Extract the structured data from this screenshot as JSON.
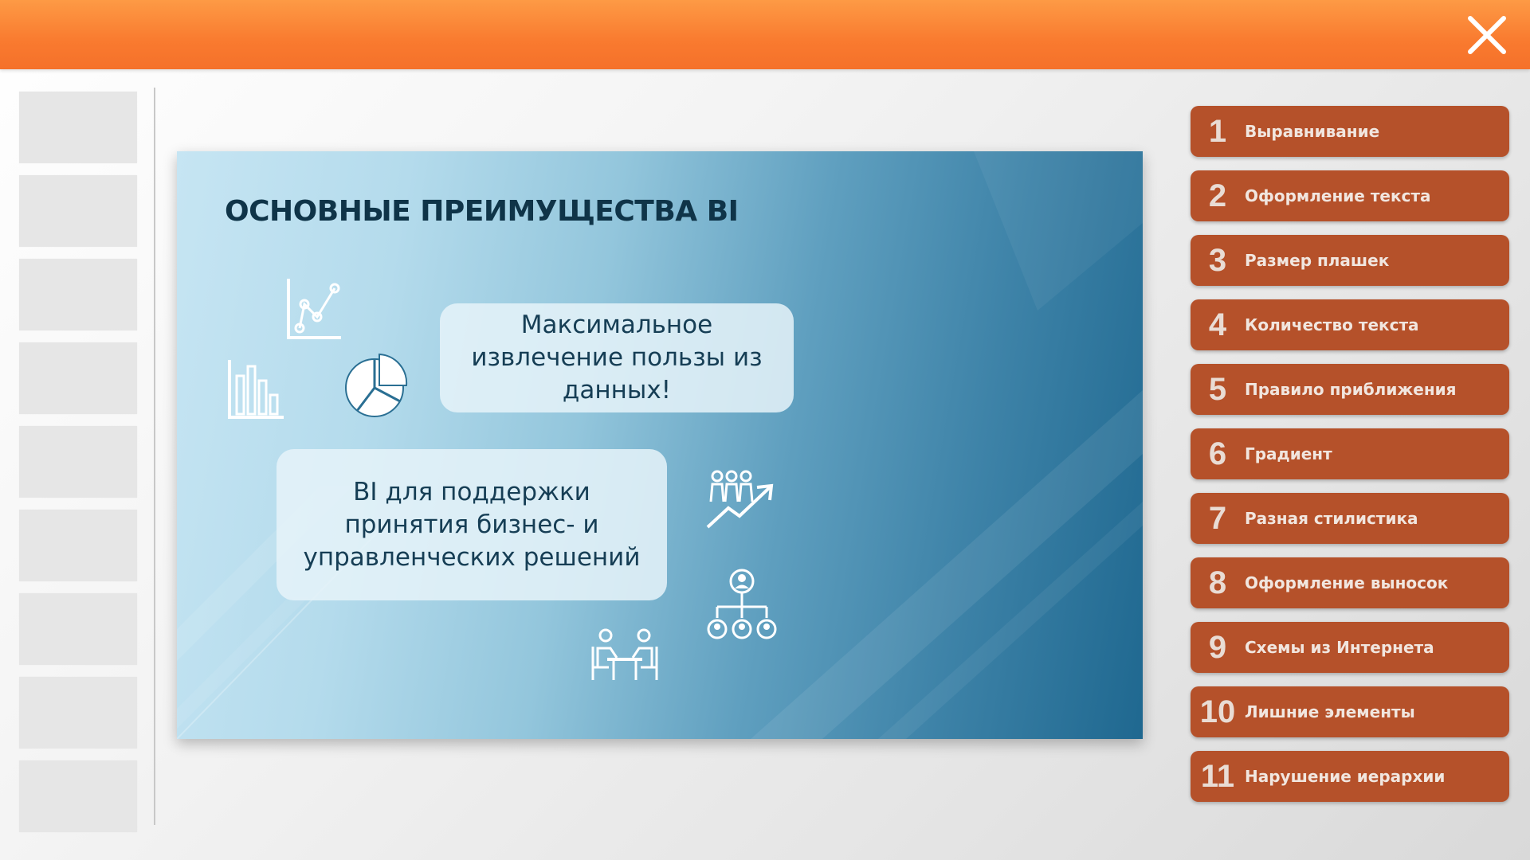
{
  "slide": {
    "title": "ОСНОВНЫЕ ПРЕИМУЩЕСТВА BI",
    "callout_1": "Максимальное извлечение пользы из данных!",
    "callout_2": "BI для поддержки принятия бизнес- и управленческих решений"
  },
  "thumbnails_count": 9,
  "criteria": [
    {
      "num": "1",
      "label": "Выравнивание"
    },
    {
      "num": "2",
      "label": "Оформление текста"
    },
    {
      "num": "3",
      "label": "Размер плашек"
    },
    {
      "num": "4",
      "label": "Количество текста"
    },
    {
      "num": "5",
      "label": "Правило приближения"
    },
    {
      "num": "6",
      "label": "Градиент"
    },
    {
      "num": "7",
      "label": "Разная стилистика"
    },
    {
      "num": "8",
      "label": "Оформление выносок"
    },
    {
      "num": "9",
      "label": "Схемы из Интернета"
    },
    {
      "num": "10",
      "label": "Лишние элементы"
    },
    {
      "num": "11",
      "label": "Нарушение иерархии"
    }
  ],
  "icons": {
    "close": "close-icon",
    "line_chart": "line-chart-icon",
    "bar_chart": "bar-chart-icon",
    "pie_chart": "pie-chart-icon",
    "team_growth": "team-growth-icon",
    "org_chart": "org-chart-icon",
    "meeting": "meeting-icon"
  },
  "colors": {
    "topbar": "#f97a2f",
    "criteria_bg": "#b5512a",
    "slide_title": "#0f3448"
  }
}
